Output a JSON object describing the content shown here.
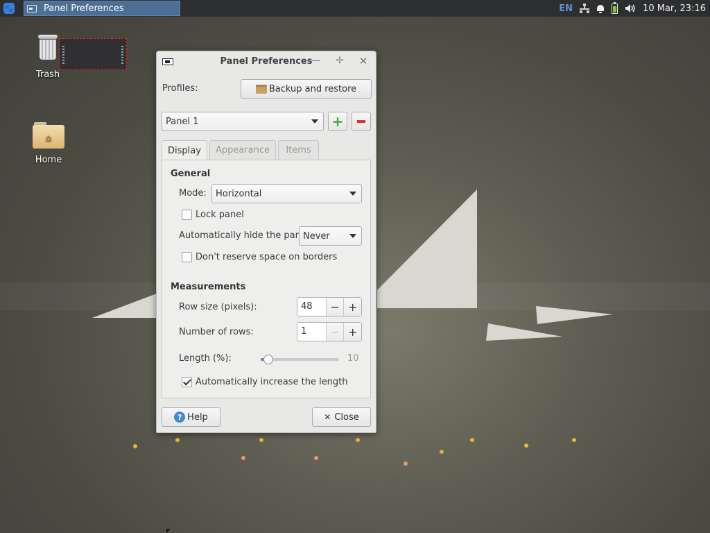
{
  "top_panel": {
    "task_title": "Panel Preferences",
    "keyboard_layout": "EN",
    "clock": "10 Mar, 23:16"
  },
  "desktop": {
    "trash_label": "Trash",
    "home_label": "Home"
  },
  "dialog": {
    "title": "Panel Preferences",
    "profiles_label": "Profiles:",
    "backup_button": "Backup and restore",
    "panel_select": "Panel 1",
    "tabs": [
      {
        "label": "Display",
        "active": true
      },
      {
        "label": "Appearance",
        "active": false
      },
      {
        "label": "Items",
        "active": false
      }
    ],
    "general": {
      "heading": "General",
      "mode_label": "Mode:",
      "mode_value": "Horizontal",
      "lock_panel_label": "Lock panel",
      "lock_panel_checked": false,
      "autohide_label": "Automatically hide the panel:",
      "autohide_value": "Never",
      "reserve_space_label": "Don't reserve space on borders",
      "reserve_space_checked": false
    },
    "measurements": {
      "heading": "Measurements",
      "row_size_label": "Row size (pixels):",
      "row_size_value": "48",
      "rows_label": "Number of rows:",
      "rows_value": "1",
      "length_label": "Length (%):",
      "length_value": "10",
      "auto_length_label": "Automatically increase the length",
      "auto_length_checked": true
    },
    "help_button": "Help",
    "close_button": "Close"
  },
  "colors": {
    "accent": "#3c80d6",
    "task_active": "#4d6f95",
    "battery": "#7ec82f",
    "add_green": "#3cb32f",
    "remove_red": "#d33333"
  }
}
